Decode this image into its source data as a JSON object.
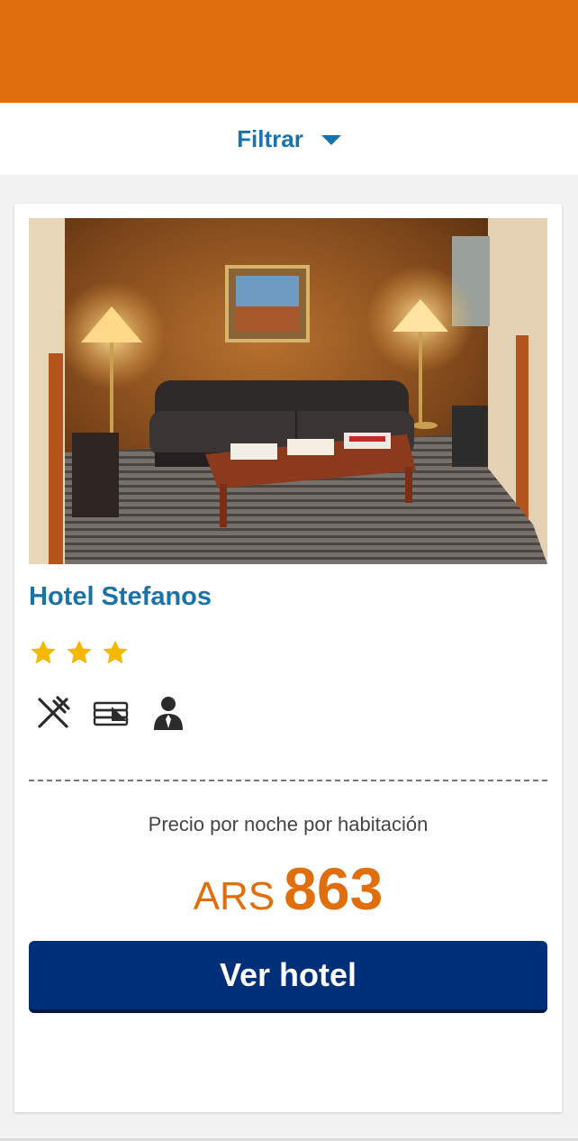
{
  "header": {
    "bar_color": "#e06e0c"
  },
  "filter": {
    "label": "Filtrar",
    "icon": "caret-down-icon"
  },
  "hotel": {
    "name": "Hotel Stefanos",
    "star_rating": 3,
    "image": "hotel-lobby-photo",
    "amenities": [
      {
        "name": "restaurant",
        "icon": "fork-knife-icon"
      },
      {
        "name": "laundry",
        "icon": "towels-icon"
      },
      {
        "name": "room-service",
        "icon": "concierge-icon"
      }
    ],
    "price_caption": "Precio por noche por habitación",
    "currency": "ARS",
    "price": "863",
    "cta_label": "Ver hotel"
  },
  "colors": {
    "accent_orange": "#e06e0c",
    "link_blue": "#1a73a8",
    "button_navy": "#002f7a",
    "star_yellow": "#f5b800"
  }
}
